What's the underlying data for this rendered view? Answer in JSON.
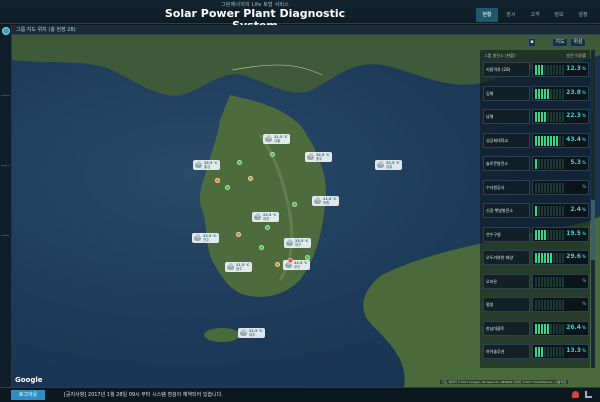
{
  "header": {
    "brand_sub": "그린에너지의 Life 토털 서비스",
    "title": "Solar Power Plant Diagnostic System",
    "nav": [
      "현황",
      "장시",
      "고객",
      "정보",
      "설정"
    ]
  },
  "map": {
    "toolbar_label": "그룹 지도 위치 (총 현장 28)",
    "view_buttons": [
      "지도",
      "위성"
    ],
    "google": "Google",
    "attribution": "지도 데이터 ©2017 Google, SK telecom, ZENRIN 이미지 ©2017 TerraMetrics | 이용약관"
  },
  "weather": [
    {
      "temp": "21.5 ℃",
      "place": "서울"
    },
    {
      "temp": "22.5 ℃",
      "place": "충주"
    },
    {
      "temp": "22.5 ℃",
      "place": "강릉"
    },
    {
      "temp": "23.5 ℃",
      "place": "홍성"
    },
    {
      "temp": "22.5 ℃",
      "place": "대전"
    },
    {
      "temp": "21.5 ℃",
      "place": "포항"
    },
    {
      "temp": "23.5 ℃",
      "place": "대구"
    },
    {
      "temp": "22.5 ℃",
      "place": "전주"
    },
    {
      "temp": "21.5 ℃",
      "place": "광주"
    },
    {
      "temp": "22.5 ℃",
      "place": "부산"
    },
    {
      "temp": "21.5 ℃",
      "place": "제주"
    }
  ],
  "panel": {
    "head_left": "그룹 발전소 (현황)",
    "head_right": "발전 이용률",
    "rows": [
      {
        "name": "지원격차 (28)",
        "value": "12.3",
        "unit": "%",
        "level": 3
      },
      {
        "name": "김해",
        "value": "23.8",
        "unit": "%",
        "level": 5
      },
      {
        "name": "남해",
        "value": "22.3",
        "unit": "%",
        "level": 4
      },
      {
        "name": "성공회대학교",
        "value": "43.4",
        "unit": "%",
        "level": 8
      },
      {
        "name": "솔로몬발전소",
        "value": "5.3",
        "unit": "%",
        "level": 1
      },
      {
        "name": "수자원공사",
        "value": "",
        "unit": "%",
        "level": 0
      },
      {
        "name": "신광 햇빛발전소",
        "value": "2.4",
        "unit": "%",
        "level": 1
      },
      {
        "name": "연수구청",
        "value": "19.5",
        "unit": "%",
        "level": 4
      },
      {
        "name": "오두기와한 태양",
        "value": "29.6",
        "unit": "%",
        "level": 6
      },
      {
        "name": "오리온",
        "value": "",
        "unit": "%",
        "level": 0
      },
      {
        "name": "평생",
        "value": "",
        "unit": "%",
        "level": 0
      },
      {
        "name": "한남마을트",
        "value": "26.4",
        "unit": "%",
        "level": 5
      },
      {
        "name": "하이솔루션",
        "value": "13.3",
        "unit": "%",
        "level": 3
      }
    ]
  },
  "footer": {
    "logout": "로그아웃",
    "notice": "[공지사항] 2017년 1월 28일 09시 부터 시스템 점검이 예약되어 있습니다."
  }
}
